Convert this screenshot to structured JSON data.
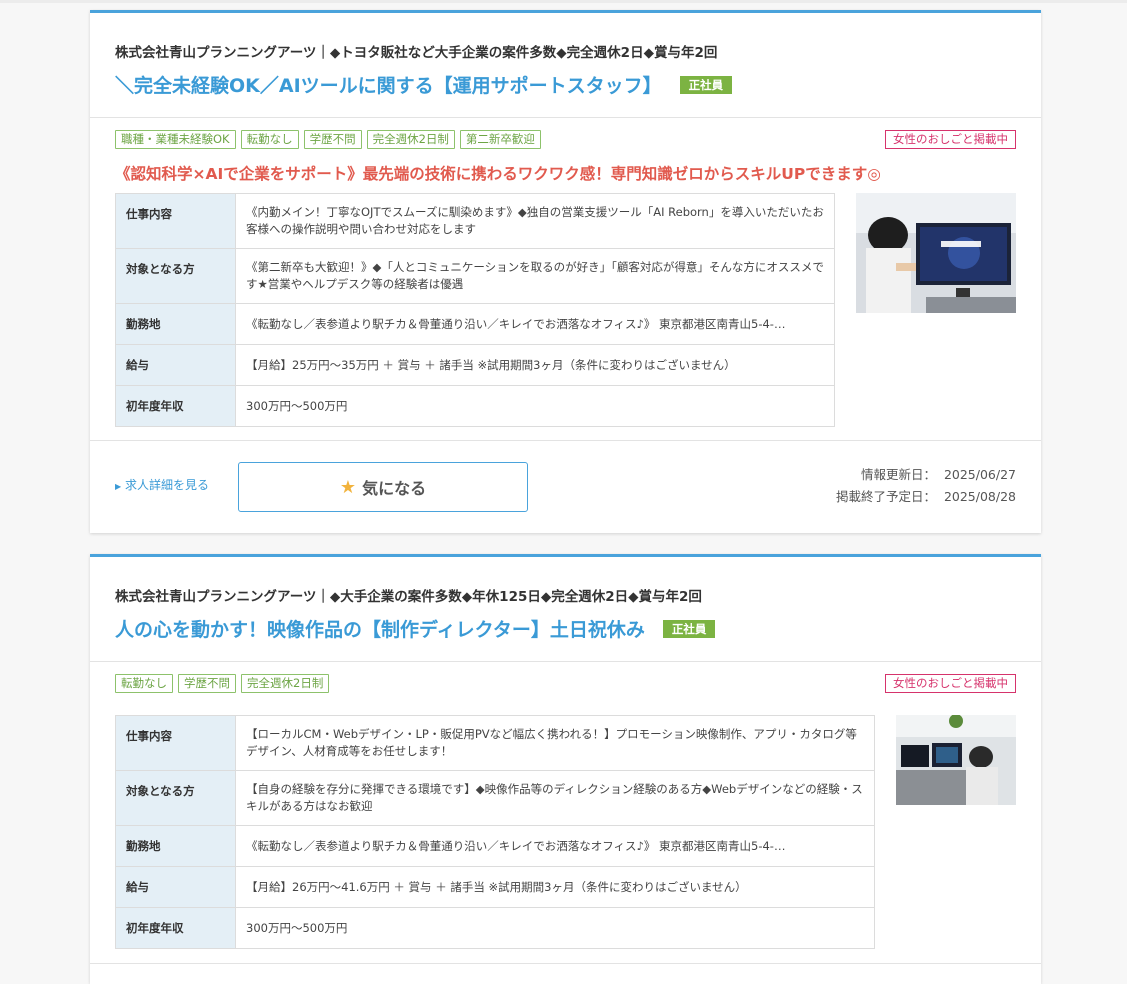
{
  "jobs": [
    {
      "company": "株式会社青山プランニングアーツ｜◆トヨタ販社など大手企業の案件多数◆完全週休2日◆賞与年2回",
      "title": "＼完全未経験OK／AIツールに関する【運用サポートスタッフ】",
      "employment": "正社員",
      "tags": [
        "職種・業種未経験OK",
        "転勤なし",
        "学歴不問",
        "完全週休2日制",
        "第二新卒歓迎"
      ],
      "women_badge": "女性のおしごと掲載中",
      "catch": "《認知科学×AIで企業をサポート》最先端の技術に携わるワクワク感！専門知識ゼロからスキルUPできます◎",
      "details": [
        {
          "label": "仕事内容",
          "value": "《内勤メイン！丁寧なOJTでスムーズに馴染めます》◆独自の営業支援ツール「AI Reborn」を導入いただいたお客様への操作説明や問い合わせ対応をします"
        },
        {
          "label": "対象となる方",
          "value": "《第二新卒も大歓迎！》◆「人とコミュニケーションを取るのが好き」「顧客対応が得意」そんな方にオススメです★営業やヘルプデスク等の経験者は優遇"
        },
        {
          "label": "勤務地",
          "value": "《転勤なし／表参道より駅チカ＆骨董通り沿い／キレイでお洒落なオフィス♪》 東京都港区南青山5-4-…"
        },
        {
          "label": "給与",
          "value": "【月給】25万円～35万円 ＋ 賞与 ＋ 諸手当 ※試用期間3ヶ月（条件に変わりはございません）"
        },
        {
          "label": "初年度年収",
          "value": "300万円～500万円"
        }
      ],
      "detail_link": "求人詳細を見る",
      "fav_label": "気になる",
      "updated_label": "情報更新日：",
      "updated_value": "2025/06/27",
      "end_label": "掲載終了予定日：",
      "end_value": "2025/08/28"
    },
    {
      "company": "株式会社青山プランニングアーツ｜◆大手企業の案件多数◆年休125日◆完全週休2日◆賞与年2回",
      "title": "人の心を動かす！映像作品の【制作ディレクター】土日祝休み",
      "employment": "正社員",
      "tags": [
        "転勤なし",
        "学歴不問",
        "完全週休2日制"
      ],
      "women_badge": "女性のおしごと掲載中",
      "details": [
        {
          "label": "仕事内容",
          "value": "【ローカルCM・Webデザイン・LP・販促用PVなど幅広く携われる！】プロモーション映像制作、アプリ・カタログ等デザイン、人材育成等をお任せします！"
        },
        {
          "label": "対象となる方",
          "value": "【自身の経験を存分に発揮できる環境です】◆映像作品等のディレクション経験のある方◆Webデザインなどの経験・スキルがある方はなお歓迎"
        },
        {
          "label": "勤務地",
          "value": "《転勤なし／表参道より駅チカ＆骨董通り沿い／キレイでお洒落なオフィス♪》 東京都港区南青山5-4-…"
        },
        {
          "label": "給与",
          "value": "【月給】26万円～41.6万円 ＋ 賞与 ＋ 諸手当 ※試用期間3ヶ月（条件に変わりはございません）"
        },
        {
          "label": "初年度年収",
          "value": "300万円～500万円"
        }
      ]
    }
  ],
  "icons": {
    "star": "star-icon",
    "arrow": "triangle-right-icon"
  },
  "colors": {
    "accent": "#4aa3dc",
    "badge_green": "#7cb342",
    "catch_red": "#e15a4e",
    "women_pink": "#d6336c"
  }
}
